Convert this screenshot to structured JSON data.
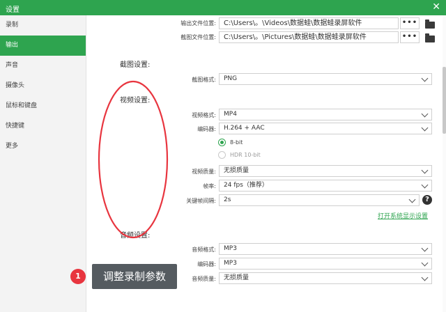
{
  "window": {
    "title": "设置",
    "close_glyph": "✕"
  },
  "sidebar": {
    "items": [
      {
        "label": "录制"
      },
      {
        "label": "输出"
      },
      {
        "label": "声音"
      },
      {
        "label": "摄像头"
      },
      {
        "label": "鼠标和键盘"
      },
      {
        "label": "快捷键"
      },
      {
        "label": "更多"
      }
    ],
    "active_index": 1
  },
  "output": {
    "output_path_label": "输出文件位置:",
    "output_path_value": "C:\\Users\\。\\Videos\\数据蛙\\数据蛙录屏软件",
    "screenshot_path_label": "截图文件位置:",
    "screenshot_path_value": "C:\\Users\\。\\Pictures\\数据蛙\\数据蛙录屏软件",
    "browse_label": "•••"
  },
  "screenshot_settings": {
    "section_label": "截图设置:",
    "format_label": "截图格式:",
    "format_value": "PNG"
  },
  "video_settings": {
    "section_label": "视频设置:",
    "format_label": "视频格式:",
    "format_value": "MP4",
    "encoder_label": "编码器:",
    "encoder_value": "H.264 + AAC",
    "bit_8_label": "8-bit",
    "hdr_label": "HDR 10-bit",
    "quality_label": "视频质量:",
    "quality_value": "无损质量",
    "framerate_label": "帧率:",
    "framerate_value": "24 fps（推荐）",
    "keyframe_label": "关键帧间隔:",
    "keyframe_value": "2s",
    "help_glyph": "?",
    "system_display_link": "打开系统显示设置"
  },
  "audio_settings": {
    "section_label": "音频设置:",
    "format_label": "音频格式:",
    "format_value": "MP3",
    "encoder_label": "编码器:",
    "encoder_value": "MP3",
    "quality_label": "音频质量:",
    "quality_value": "无损质量"
  },
  "annotation": {
    "step_number": "1",
    "step_text": "调整录制参数",
    "ellipse_color": "#e8353f"
  },
  "colors": {
    "accent": "#2ea44f"
  }
}
